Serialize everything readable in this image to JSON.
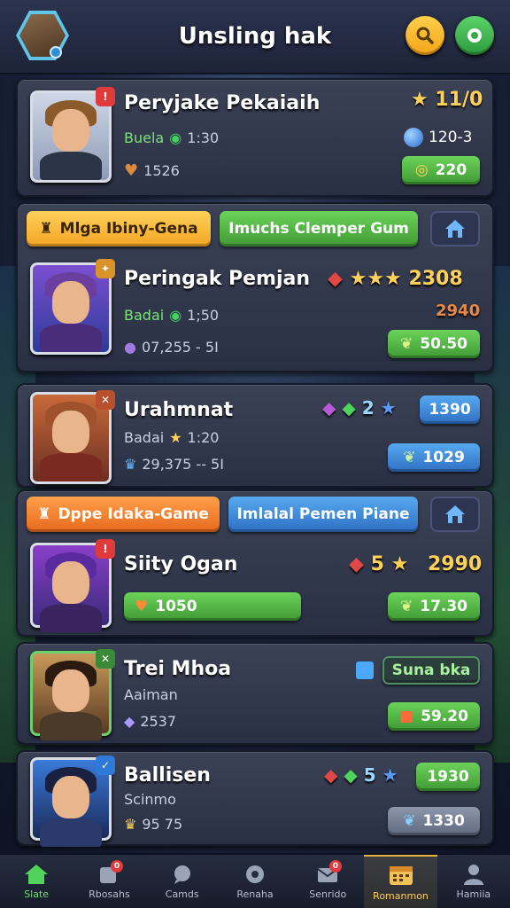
{
  "header": {
    "title": "Unsling hak"
  },
  "cards": [
    {
      "name": "Peryjake Pekaiaih",
      "sub_label": "Buela",
      "sub_value": "1:30",
      "sub2_value": "1526",
      "rating": "11/0",
      "stat": "120-3",
      "btn_value": "220"
    },
    {
      "banner_left": "Mlga Ibiny-Gena",
      "banner_right": "Imuchs Clemper Gum",
      "name": "Peringak Pemjan",
      "sub_label": "Badai",
      "sub_value": "1;50",
      "sub2_value": "07,255 - 5I",
      "score": "2308",
      "stat": "2940",
      "btn_value": "50.50"
    },
    {
      "name": "Urahmnat",
      "sub_label": "Badai",
      "sub_value": "1:20",
      "sub2_value": "29,375 -- 5I",
      "score": "2",
      "btn_top": "1390",
      "btn_bottom": "1029"
    },
    {
      "banner_left": "Dppe Idaka-Game",
      "banner_right": "Imlalal Pemen Piane",
      "name": "Siity Ogan",
      "score_a": "5",
      "score_b": "2990",
      "bar_value": "1050",
      "btn_value": "17.30"
    },
    {
      "name": "Trei Mhoa",
      "sub_label": "Aaiman",
      "sub2_value": "2537",
      "tag": "Suna bka",
      "btn_value": "59.20"
    },
    {
      "name": "Ballisen",
      "sub_label": "Scinmo",
      "sub2_value": "95 75",
      "score": "5",
      "btn_top": "1930",
      "btn_bottom": "1330"
    }
  ],
  "nav": [
    {
      "label": "Slate",
      "icon": "home-icon"
    },
    {
      "label": "Rbosahs",
      "icon": "cards-icon",
      "badge": "0"
    },
    {
      "label": "Camds",
      "icon": "chat-icon"
    },
    {
      "label": "Renaha",
      "icon": "puzzle-icon"
    },
    {
      "label": "Senrido",
      "icon": "mail-icon",
      "badge": "0"
    },
    {
      "label": "Romanmon",
      "icon": "calendar-icon"
    },
    {
      "label": "Hamiia",
      "icon": "profile-icon"
    }
  ],
  "colors": {
    "accent_green": "#4fb842",
    "accent_blue": "#2f6fc4",
    "accent_gold": "#f2a424",
    "accent_orange": "#e6691e"
  }
}
